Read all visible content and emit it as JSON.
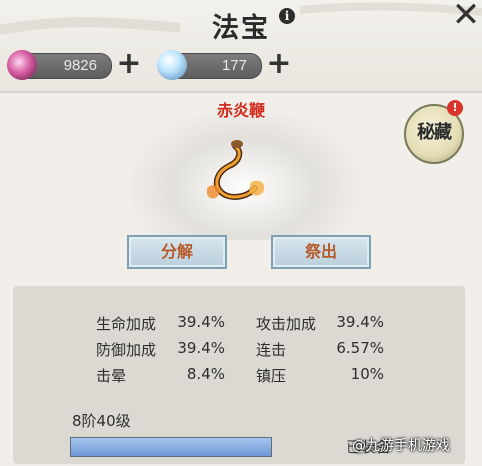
{
  "header": {
    "title": "法宝",
    "info_icon": "info-icon",
    "close_icon": "close-icon"
  },
  "currencies": [
    {
      "icon": "gem-icon",
      "value": "9826"
    },
    {
      "icon": "orb-icon",
      "value": "177"
    }
  ],
  "plus_glyph": "+",
  "item": {
    "name": "赤炎鞭",
    "icon": "flame-whip-icon"
  },
  "hidden_badge": {
    "label": "秘藏",
    "alert": "!"
  },
  "actions": {
    "decompose_label": "分解",
    "deploy_label": "祭出"
  },
  "stats": [
    {
      "label": "生命加成",
      "value": "39.4%"
    },
    {
      "label": "攻击加成",
      "value": "39.4%"
    },
    {
      "label": "防御加成",
      "value": "39.4%"
    },
    {
      "label": "连击",
      "value": "6.57%"
    },
    {
      "label": "击晕",
      "value": "8.4%"
    },
    {
      "label": "镇压",
      "value": "10%"
    }
  ],
  "level": {
    "text": "8阶40级",
    "progress": 1.0
  },
  "status": {
    "equipped_text": "已装备"
  },
  "watermark": "@九游手机游戏",
  "colors": {
    "item_name": "#d02a1a",
    "button_text": "#b65a2a",
    "level_fill": "#6d98d6"
  }
}
